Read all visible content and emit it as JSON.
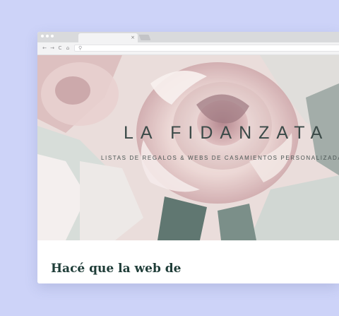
{
  "browser": {
    "tab_close": "×",
    "nav": {
      "back": "←",
      "forward": "→",
      "reload": "C",
      "home": "⌂"
    },
    "address_icon": "search-icon"
  },
  "hero": {
    "title": "LA FIDANZATA",
    "subtitle": "LISTAS DE REGALOS & WEBS DE CASAMIENTOS PERSONALIZADAS"
  },
  "content": {
    "headline": "Hacé que la web de"
  },
  "colors": {
    "background": "#cdd3f8",
    "title_text": "#3b4a48",
    "headline_text": "#1f3d38"
  }
}
